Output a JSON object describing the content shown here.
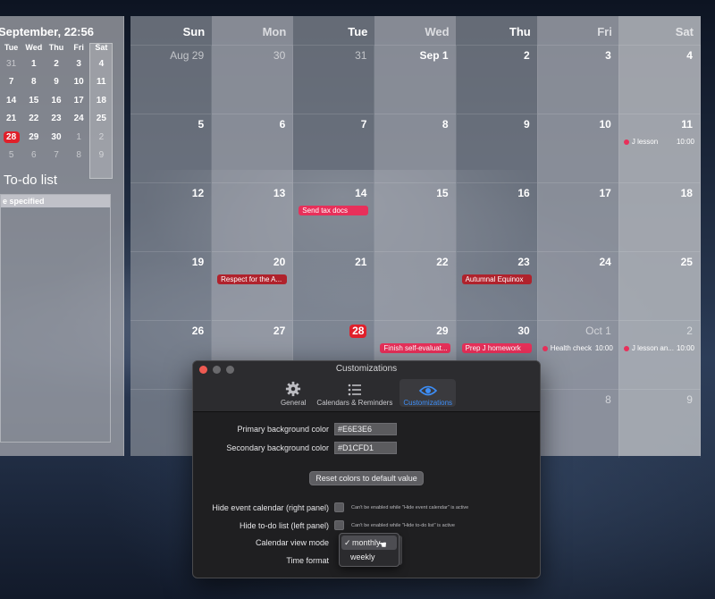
{
  "left_panel": {
    "clock": "September, 22:56",
    "mini_weekdays": [
      "Tue",
      "Wed",
      "Thu",
      "Fri",
      "Sat"
    ],
    "mini_weeks": [
      [
        {
          "d": "31",
          "dim": true
        },
        {
          "d": "1"
        },
        {
          "d": "2"
        },
        {
          "d": "3"
        },
        {
          "d": "4"
        }
      ],
      [
        {
          "d": "7"
        },
        {
          "d": "8"
        },
        {
          "d": "9"
        },
        {
          "d": "10"
        },
        {
          "d": "11"
        }
      ],
      [
        {
          "d": "14"
        },
        {
          "d": "15"
        },
        {
          "d": "16"
        },
        {
          "d": "17"
        },
        {
          "d": "18"
        }
      ],
      [
        {
          "d": "21"
        },
        {
          "d": "22"
        },
        {
          "d": "23"
        },
        {
          "d": "24"
        },
        {
          "d": "25"
        }
      ],
      [
        {
          "d": "28",
          "today": true
        },
        {
          "d": "29"
        },
        {
          "d": "30"
        },
        {
          "d": "1",
          "dim": true
        },
        {
          "d": "2",
          "dim": true
        }
      ],
      [
        {
          "d": "5",
          "dim": true
        },
        {
          "d": "6",
          "dim": true
        },
        {
          "d": "7",
          "dim": true
        },
        {
          "d": "8",
          "dim": true
        },
        {
          "d": "9",
          "dim": true
        }
      ]
    ],
    "todo_title": "To-do list",
    "todo_items": [
      "e specified"
    ]
  },
  "calendar": {
    "weekdays": [
      "Sun",
      "Mon",
      "Tue",
      "Wed",
      "Thu",
      "Fri",
      "Sat"
    ],
    "weeks": [
      [
        {
          "d": "Aug 29",
          "dim": true
        },
        {
          "d": "30",
          "dim": true
        },
        {
          "d": "31",
          "dim": true
        },
        {
          "d": "Sep 1"
        },
        {
          "d": "2"
        },
        {
          "d": "3"
        },
        {
          "d": "4"
        }
      ],
      [
        {
          "d": "5"
        },
        {
          "d": "6"
        },
        {
          "d": "7"
        },
        {
          "d": "8"
        },
        {
          "d": "9"
        },
        {
          "d": "10"
        },
        {
          "d": "11",
          "dot": {
            "title": "J lesson",
            "time": "10:00"
          }
        }
      ],
      [
        {
          "d": "12"
        },
        {
          "d": "13"
        },
        {
          "d": "14",
          "bar": {
            "title": "Send tax docs",
            "color": "#e8305a"
          }
        },
        {
          "d": "15"
        },
        {
          "d": "16"
        },
        {
          "d": "17"
        },
        {
          "d": "18"
        }
      ],
      [
        {
          "d": "19"
        },
        {
          "d": "20",
          "bar": {
            "title": "Respect for the A...",
            "color": "#b0222c"
          }
        },
        {
          "d": "21"
        },
        {
          "d": "22"
        },
        {
          "d": "23",
          "bar": {
            "title": "Autumnal Equinox",
            "color": "#b0222c"
          }
        },
        {
          "d": "24"
        },
        {
          "d": "25"
        }
      ],
      [
        {
          "d": "26"
        },
        {
          "d": "27"
        },
        {
          "d": "28",
          "today": true
        },
        {
          "d": "29",
          "bar": {
            "title": "Finish self-evaluat...",
            "color": "#e8305a"
          }
        },
        {
          "d": "30",
          "bar": {
            "title": "Prep J homework",
            "color": "#e8305a"
          }
        },
        {
          "d": "Oct 1",
          "dim": true,
          "dot": {
            "title": "Health check",
            "time": "10:00"
          }
        },
        {
          "d": "2",
          "dim": true,
          "dot": {
            "title": "J lesson an...",
            "time": "10:00"
          }
        }
      ],
      [
        {
          "d": ""
        },
        {
          "d": ""
        },
        {
          "d": ""
        },
        {
          "d": ""
        },
        {
          "d": ""
        },
        {
          "d": "8",
          "dim": true
        },
        {
          "d": "9",
          "dim": true
        }
      ]
    ]
  },
  "dialog": {
    "title": "Customizations",
    "tabs": [
      {
        "label": "General",
        "icon": "gear-icon",
        "active": false
      },
      {
        "label": "Calendars & Reminders",
        "icon": "list-icon",
        "active": false
      },
      {
        "label": "Customizations",
        "icon": "eye-icon",
        "active": true
      }
    ],
    "primary_bg_label": "Primary background color",
    "primary_bg_value": "#E6E3E6",
    "secondary_bg_label": "Secondary background color",
    "secondary_bg_value": "#D1CFD1",
    "reset_label": "Reset colors to default value",
    "hide_event_label": "Hide event calendar (right panel)",
    "hide_event_hint": "Can't be enabled while \"Hide event calendar\" is active",
    "hide_todo_label": "Hide to-do list (left panel)",
    "hide_todo_hint": "Can't be enabled while \"Hide to-do list\" is active",
    "view_mode_label": "Calendar view mode",
    "time_format_label": "Time format",
    "view_mode_options": [
      "monthly",
      "weekly"
    ],
    "view_mode_selected": "monthly"
  },
  "colors": {
    "accent": "#3d8ef7",
    "today": "#e0202a",
    "event_pink": "#e8305a",
    "event_dark": "#b0222c"
  }
}
